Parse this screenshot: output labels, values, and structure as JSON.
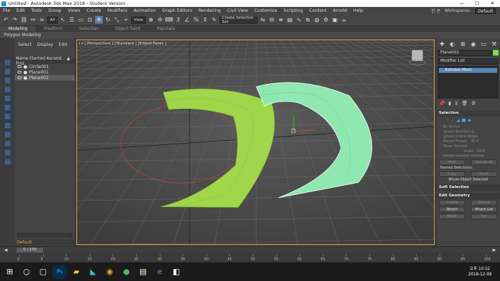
{
  "window": {
    "title": "Untitled - Autodesk 3ds Max 2018 - Student Version",
    "controls": [
      "—",
      "☐",
      "✕"
    ]
  },
  "menu": {
    "items": [
      "File",
      "Edit",
      "Tools",
      "Group",
      "Views",
      "Create",
      "Modifiers",
      "Animation",
      "Graph Editors",
      "Rendering",
      "Civil View",
      "Customize",
      "Scripting",
      "Content",
      "Arnold",
      "Help"
    ],
    "user": "한 준",
    "workspaces_label": "Workspaces:",
    "workspace_value": "Default"
  },
  "toolbar": {
    "filter": "All",
    "view": "View",
    "selection_set": "Create Selection Set"
  },
  "ribbon": {
    "tabs": [
      "Modeling",
      "Freeform",
      "Selection",
      "Object Paint",
      "Populate"
    ],
    "active": "Modeling",
    "panel_label": "Polygon Modeling"
  },
  "explorer": {
    "tabs": [
      "Select",
      "Display",
      "Edit"
    ],
    "header": "Name (Sorted Ascend... ▲ Froz",
    "objects": [
      {
        "name": "Circle001",
        "selected": false
      },
      {
        "name": "Plane001",
        "selected": false
      },
      {
        "name": "Plane002",
        "selected": true
      }
    ],
    "layer": "Default"
  },
  "viewport": {
    "label": "[+] [Perspective ] [Standard ] [Edged Faces ]"
  },
  "command_panel": {
    "object_name": "Plane002",
    "modifier_list": "Modifier List",
    "stack_item": "Editable Mesh",
    "selection_title": "Selection",
    "by_vertex": "By Vertex",
    "ignore_backfacing": "Ignore Backfacing",
    "ignore_visible_edges": "Ignore Visible Edges",
    "planar_thresh_label": "Planar Thresh:",
    "planar_thresh_value": "45.0",
    "show_normals": "Show Normals",
    "scale_label": "Scale:",
    "scale_value": "20.0",
    "delete_isolated": "Delete Isolated Vertices",
    "hide": "Hide",
    "unhide_all": "Unhide All",
    "named_selections": "Named Selections:",
    "copy": "Copy",
    "paste": "Paste",
    "whole_object": "Whole Object Selected",
    "soft_selection": "Soft Selection",
    "edit_geometry": "Edit Geometry",
    "create": "Create",
    "delete": "Delete",
    "attach": "Attach",
    "attach_list": "Attach List",
    "break": "Break",
    "turn": "Turn"
  },
  "timeline": {
    "frame": "0 / 100",
    "ticks": [
      "0",
      "5",
      "10",
      "15",
      "20",
      "25",
      "30",
      "35",
      "40",
      "45",
      "50",
      "55",
      "60",
      "65",
      "70",
      "75",
      "80",
      "85",
      "90",
      "95",
      "100"
    ]
  },
  "taskbar": {
    "time": "오후 10:52",
    "date": "2018-12-09"
  },
  "colors": {
    "mesh_green": "#9fd64a",
    "mesh_teal": "#8ee8b0",
    "viewport_border": "#d9a441",
    "selection_blue": "#5486b8"
  }
}
